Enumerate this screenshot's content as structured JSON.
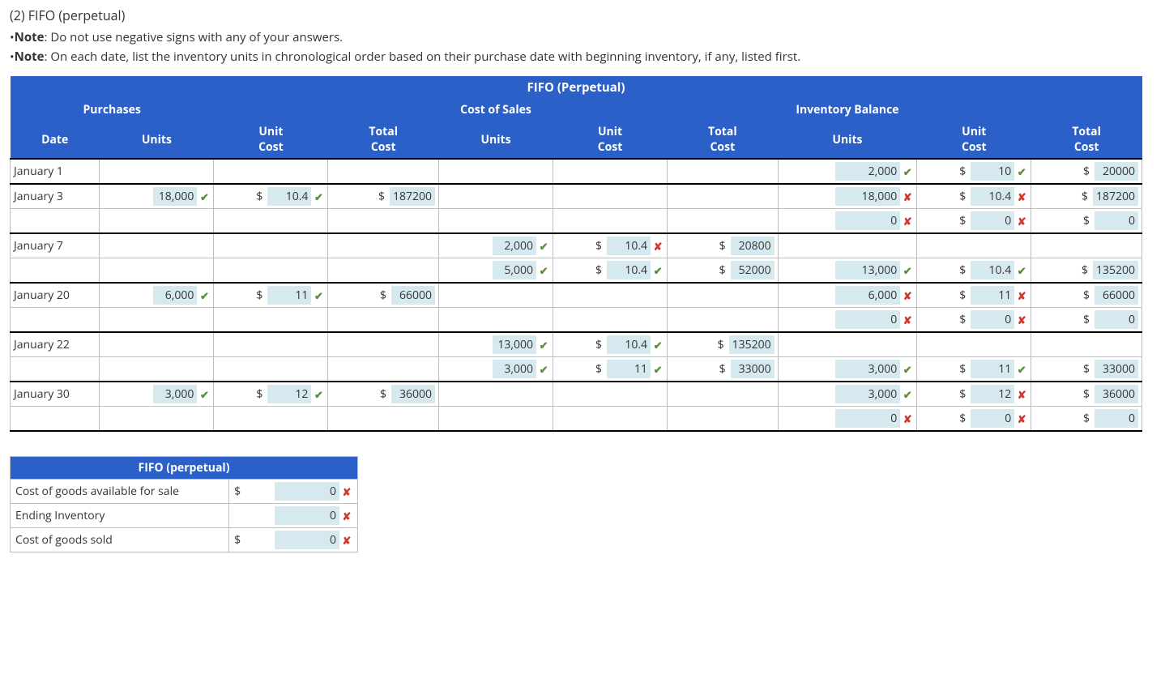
{
  "heading": "(2) FIFO (perpetual)",
  "notes": {
    "label": "Note",
    "n1": ": Do not use negative signs with any of your answers.",
    "n2": ": On each date, list the inventory units in chronological order based on their purchase date with beginning inventory, if any, listed first."
  },
  "tableHeader": {
    "top": "FIFO (Perpetual)",
    "purchases": "Purchases",
    "cos": "Cost of Sales",
    "inv": "Inventory Balance",
    "date": "Date",
    "units": "Units",
    "unitCost": "Unit Cost",
    "totalCost": "Total Cost"
  },
  "rows": [
    {
      "top": true,
      "date": "January 1",
      "p": {
        "units": "",
        "uc": "",
        "tc": ""
      },
      "c": {
        "units": "",
        "uc": "",
        "tc": ""
      },
      "i": {
        "units": "2,000",
        "um": "ok",
        "uc": "10",
        "ucm": "ok",
        "tc": "20000"
      }
    },
    {
      "top": true,
      "date": "January 3",
      "p": {
        "units": "18,000",
        "um": "ok",
        "uc": "10.4",
        "ucm": "ok",
        "tc": "187200"
      },
      "c": {
        "units": "",
        "uc": "",
        "tc": ""
      },
      "i": {
        "units": "18,000",
        "um": "bad",
        "uc": "10.4",
        "ucm": "bad",
        "tc": "187200"
      }
    },
    {
      "date": "",
      "p": {
        "units": "",
        "uc": "",
        "tc": ""
      },
      "c": {
        "units": "",
        "uc": "",
        "tc": ""
      },
      "i": {
        "units": "0",
        "um": "bad",
        "uc": "0",
        "ucm": "bad",
        "tc": "0"
      }
    },
    {
      "top": true,
      "date": "January 7",
      "p": {
        "units": "",
        "uc": "",
        "tc": ""
      },
      "c": {
        "units": "2,000",
        "um": "ok",
        "uc": "10.4",
        "ucm": "bad",
        "tc": "20800"
      },
      "i": {
        "units": "",
        "uc": "",
        "tc": ""
      }
    },
    {
      "date": "",
      "p": {
        "units": "",
        "uc": "",
        "tc": ""
      },
      "c": {
        "units": "5,000",
        "um": "ok",
        "uc": "10.4",
        "ucm": "ok",
        "tc": "52000"
      },
      "i": {
        "units": "13,000",
        "um": "ok",
        "uc": "10.4",
        "ucm": "ok",
        "tc": "135200"
      }
    },
    {
      "top": true,
      "date": "January 20",
      "p": {
        "units": "6,000",
        "um": "ok",
        "uc": "11",
        "ucm": "ok",
        "tc": "66000"
      },
      "c": {
        "units": "",
        "uc": "",
        "tc": ""
      },
      "i": {
        "units": "6,000",
        "um": "bad",
        "uc": "11",
        "ucm": "bad",
        "tc": "66000"
      }
    },
    {
      "date": "",
      "p": {
        "units": "",
        "uc": "",
        "tc": ""
      },
      "c": {
        "units": "",
        "uc": "",
        "tc": ""
      },
      "i": {
        "units": "0",
        "um": "bad",
        "uc": "0",
        "ucm": "bad",
        "tc": "0"
      }
    },
    {
      "top": true,
      "date": "January 22",
      "p": {
        "units": "",
        "uc": "",
        "tc": ""
      },
      "c": {
        "units": "13,000",
        "um": "ok",
        "uc": "10.4",
        "ucm": "ok",
        "tc": "135200"
      },
      "i": {
        "units": "",
        "uc": "",
        "tc": ""
      }
    },
    {
      "date": "",
      "p": {
        "units": "",
        "uc": "",
        "tc": ""
      },
      "c": {
        "units": "3,000",
        "um": "ok",
        "uc": "11",
        "ucm": "ok",
        "tc": "33000"
      },
      "i": {
        "units": "3,000",
        "um": "ok",
        "uc": "11",
        "ucm": "ok",
        "tc": "33000"
      }
    },
    {
      "top": true,
      "date": "January 30",
      "p": {
        "units": "3,000",
        "um": "ok",
        "uc": "12",
        "ucm": "ok",
        "tc": "36000"
      },
      "c": {
        "units": "",
        "uc": "",
        "tc": ""
      },
      "i": {
        "units": "3,000",
        "um": "ok",
        "uc": "12",
        "ucm": "bad",
        "tc": "36000"
      }
    },
    {
      "date": "",
      "p": {
        "units": "",
        "uc": "",
        "tc": ""
      },
      "c": {
        "units": "",
        "uc": "",
        "tc": ""
      },
      "i": {
        "units": "0",
        "um": "bad",
        "uc": "0",
        "ucm": "bad",
        "tc": "0"
      }
    }
  ],
  "summary": {
    "title": "FIFO (perpetual)",
    "rows": [
      {
        "label": "Cost of goods available for sale",
        "dollar": "$",
        "val": "0",
        "mark": "bad"
      },
      {
        "label": "Ending Inventory",
        "dollar": "",
        "val": "0",
        "mark": "bad"
      },
      {
        "label": "Cost of goods sold",
        "dollar": "$",
        "val": "0",
        "mark": "bad"
      }
    ]
  }
}
